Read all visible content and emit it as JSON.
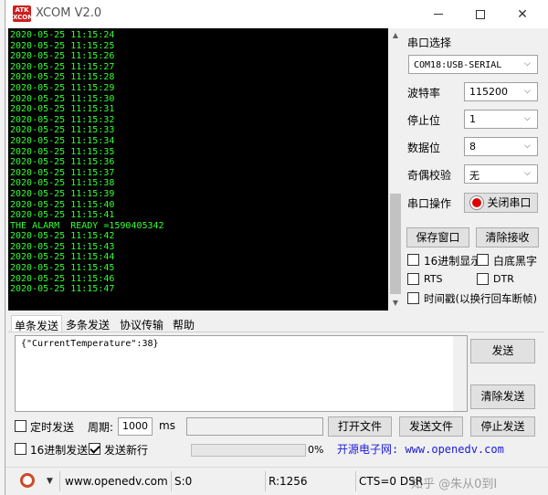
{
  "window": {
    "logo_line1": "ATK",
    "logo_line2": "XCOM",
    "title": "XCOM V2.0"
  },
  "receive": {
    "lines": [
      "2020-05-25 11:15:24",
      "2020-05-25 11:15:25",
      "2020-05-25 11:15:26",
      "2020-05-25 11:15:27",
      "2020-05-25 11:15:28",
      "2020-05-25 11:15:29",
      "2020-05-25 11:15:30",
      "2020-05-25 11:15:31",
      "2020-05-25 11:15:32",
      "2020-05-25 11:15:33",
      "2020-05-25 11:15:34",
      "2020-05-25 11:15:35",
      "2020-05-25 11:15:36",
      "2020-05-25 11:15:37",
      "2020-05-25 11:15:38",
      "2020-05-25 11:15:39",
      "2020-05-25 11:15:40",
      "2020-05-25 11:15:41",
      "THE ALARM  READY =1590405342",
      "2020-05-25 11:15:42",
      "2020-05-25 11:15:43",
      "2020-05-25 11:15:44",
      "2020-05-25 11:15:45",
      "2020-05-25 11:15:46",
      "2020-05-25 11:15:47"
    ]
  },
  "serial": {
    "port_select_label": "串口选择",
    "port_value": "COM18:USB-SERIAL",
    "baud_label": "波特率",
    "baud_value": "115200",
    "stop_label": "停止位",
    "stop_value": "1",
    "data_label": "数据位",
    "data_value": "8",
    "parity_label": "奇偶校验",
    "parity_value": "无",
    "op_label": "串口操作",
    "close_port_label": "关闭串口",
    "save_window_label": "保存窗口",
    "clear_recv_label": "清除接收",
    "hex_display_label": "16进制显示",
    "white_bg_label": "白底黑字",
    "rts_label": "RTS",
    "dtr_label": "DTR",
    "timestamp_label": "时间戳(以换行回车断帧)"
  },
  "tabs": [
    "单条发送",
    "多条发送",
    "协议传输",
    "帮助"
  ],
  "send": {
    "text": "{\"CurrentTemperature\":38}",
    "send_label": "发送",
    "clear_send_label": "清除发送",
    "timed_send_label": "定时发送",
    "period_label": "周期:",
    "period_value": "1000",
    "period_unit": "ms",
    "open_file_label": "打开文件",
    "send_file_label": "发送文件",
    "stop_send_label": "停止发送",
    "hex_send_label": "16进制发送",
    "send_newline_label": "发送新行",
    "progress_text": "0%",
    "progress": 0,
    "brand": "开源电子网: www.openedv.com"
  },
  "status": {
    "url": "www.openedv.com",
    "sent": "S:0",
    "received": "R:1256",
    "lines": "CTS=0 DSR",
    "watermark": "知乎 @朱从0到I"
  }
}
